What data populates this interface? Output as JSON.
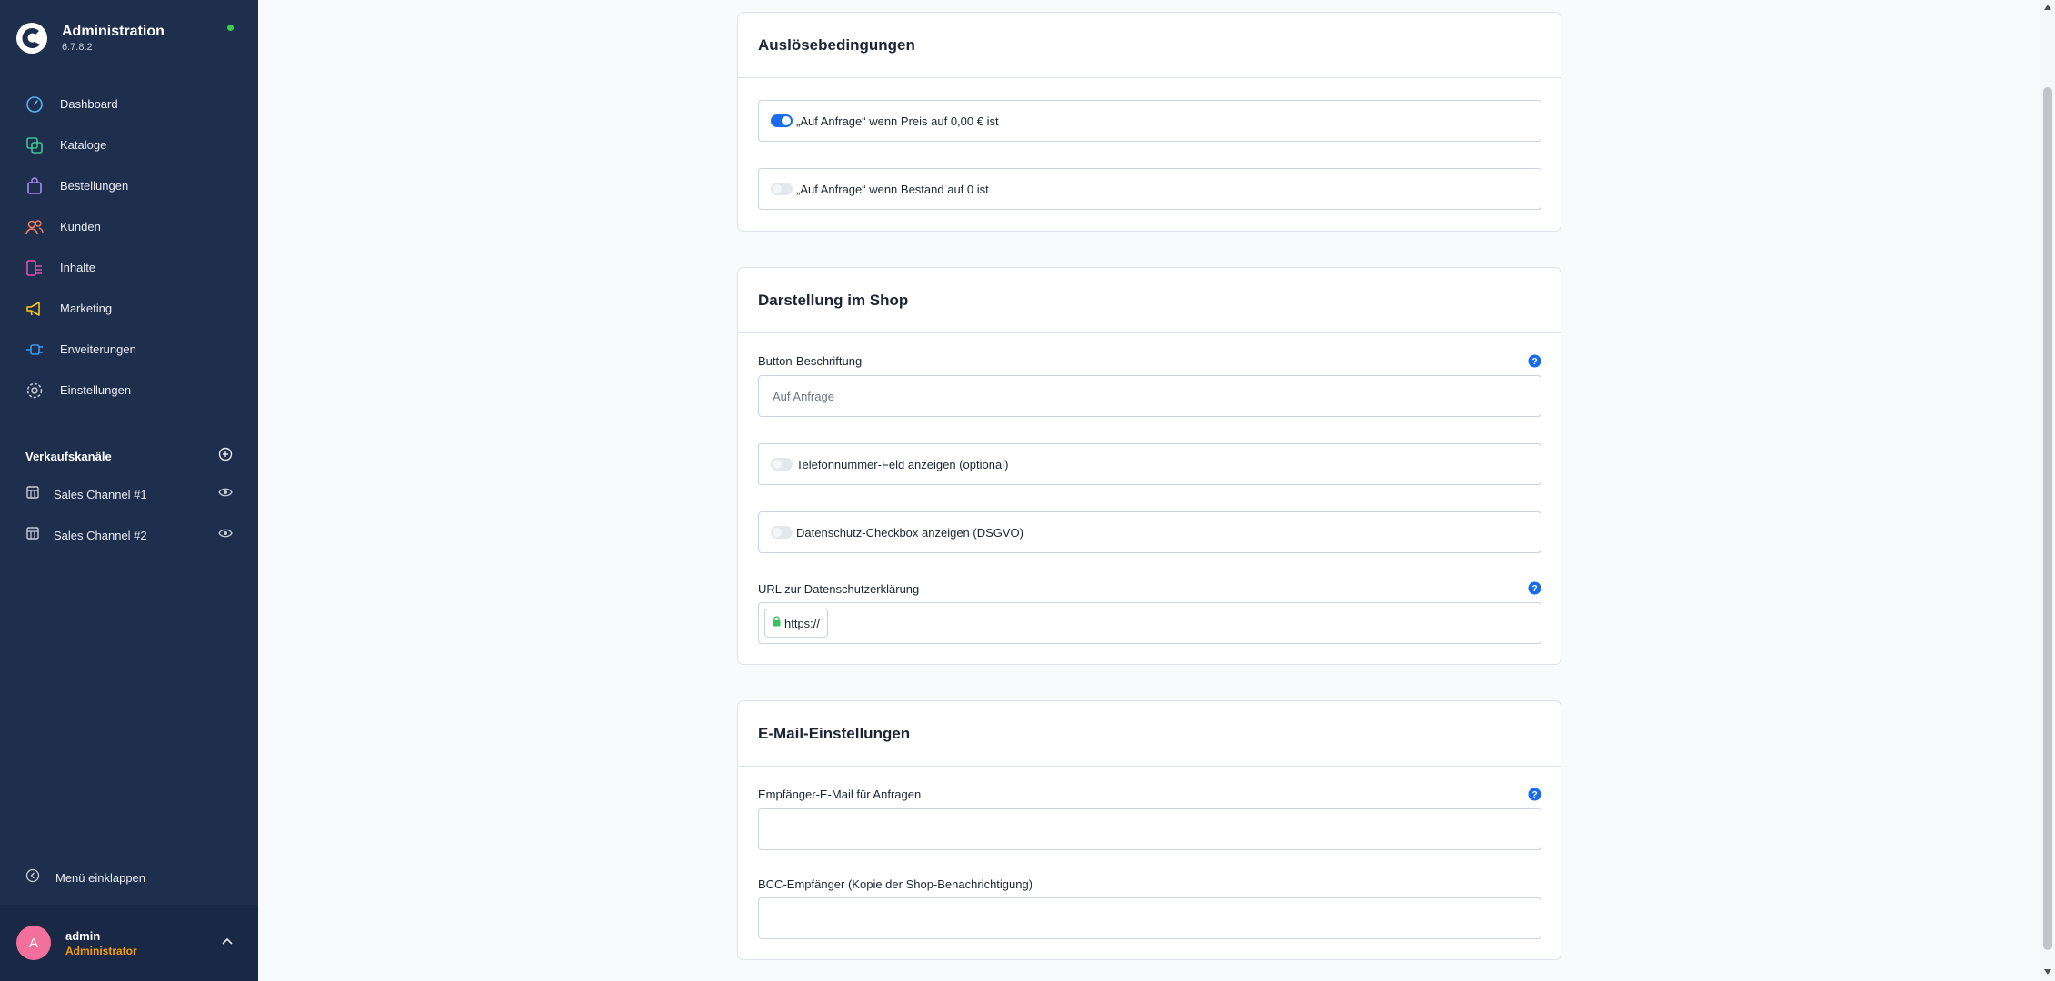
{
  "app": {
    "title": "Administration",
    "version": "6.7.8.2"
  },
  "sidebar": {
    "items": [
      {
        "label": "Dashboard",
        "icon": "gauge-icon",
        "color": "#57b3f5"
      },
      {
        "label": "Kataloge",
        "icon": "stacked-squares-icon",
        "color": "#3fc48f"
      },
      {
        "label": "Bestellungen",
        "icon": "shopping-bag-icon",
        "color": "#a58cf4"
      },
      {
        "label": "Kunden",
        "icon": "users-icon",
        "color": "#f07e5f"
      },
      {
        "label": "Inhalte",
        "icon": "content-list-icon",
        "color": "#e24fb0"
      },
      {
        "label": "Marketing",
        "icon": "megaphone-icon",
        "color": "#f5c518"
      },
      {
        "label": "Erweiterungen",
        "icon": "plug-icon",
        "color": "#3c9bf0"
      },
      {
        "label": "Einstellungen",
        "icon": "gear-icon",
        "color": "#c1c8d3"
      }
    ],
    "channels_title": "Verkaufskanäle",
    "channels": [
      {
        "label": "Sales Channel #1"
      },
      {
        "label": "Sales Channel #2"
      }
    ],
    "collapse_label": "Menü einklappen",
    "user": {
      "initial": "A",
      "name": "admin",
      "role": "Administrator"
    }
  },
  "sections": {
    "triggers": {
      "title": "Auslösebedingungen",
      "switch_price": {
        "label": "„Auf Anfrage“ wenn Preis auf 0,00 € ist",
        "checked": true
      },
      "switch_stock": {
        "label": "„Auf Anfrage“ wenn Bestand auf 0 ist",
        "checked": false
      }
    },
    "display": {
      "title": "Darstellung im Shop",
      "button_label_field": {
        "label": "Button-Beschriftung",
        "placeholder": "Auf Anfrage",
        "value": ""
      },
      "switch_phone": {
        "label": "Telefonnummer-Feld anzeigen (optional)",
        "checked": false
      },
      "switch_privacy": {
        "label": "Datenschutz-Checkbox anzeigen (DSGVO)",
        "checked": false
      },
      "privacy_url_field": {
        "label": "URL zur Datenschutzerklärung",
        "prefix": "https://",
        "value": ""
      }
    },
    "email": {
      "title": "E-Mail-Einstellungen",
      "recipient_field": {
        "label": "Empfänger-E-Mail für Anfragen",
        "value": ""
      },
      "bcc_field": {
        "label": "BCC-Empfänger (Kopie der Shop-Benachrichtigung)",
        "value": ""
      }
    }
  },
  "colors": {
    "sidebar_bg": "#1e2f4d",
    "accent": "#1b6ce8",
    "status_online": "#37d046",
    "role_text": "#f59f00",
    "avatar_bg": "#f3709b"
  }
}
